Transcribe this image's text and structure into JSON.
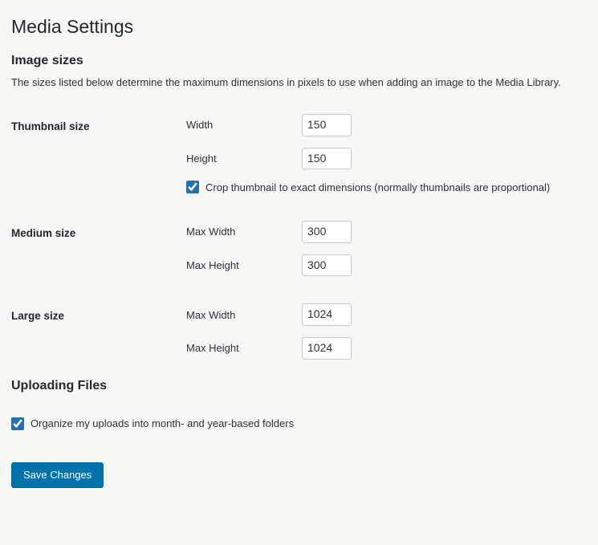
{
  "page_title": "Media Settings",
  "image_sizes": {
    "heading": "Image sizes",
    "description": "The sizes listed below determine the maximum dimensions in pixels to use when adding an image to the Media Library.",
    "thumbnail": {
      "label": "Thumbnail size",
      "width_label": "Width",
      "width_value": "150",
      "height_label": "Height",
      "height_value": "150",
      "crop_label": "Crop thumbnail to exact dimensions (normally thumbnails are proportional)",
      "crop_checked": true
    },
    "medium": {
      "label": "Medium size",
      "max_width_label": "Max Width",
      "max_width_value": "300",
      "max_height_label": "Max Height",
      "max_height_value": "300"
    },
    "large": {
      "label": "Large size",
      "max_width_label": "Max Width",
      "max_width_value": "1024",
      "max_height_label": "Max Height",
      "max_height_value": "1024"
    }
  },
  "uploading": {
    "heading": "Uploading Files",
    "organize_label": "Organize my uploads into month- and year-based folders",
    "organize_checked": true
  },
  "save_button": "Save Changes"
}
